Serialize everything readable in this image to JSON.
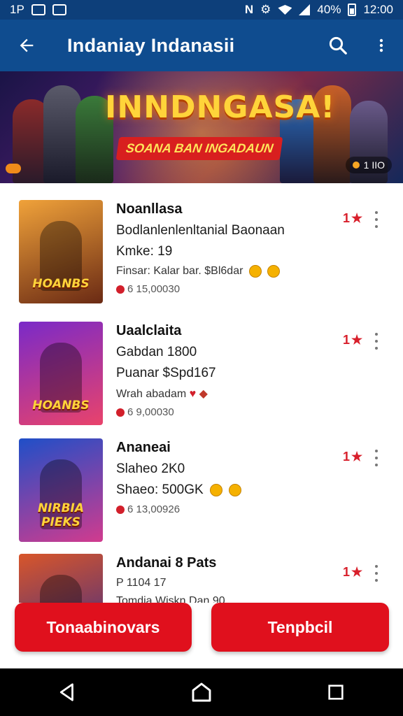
{
  "status_bar": {
    "left_text": "1P",
    "battery": "40%",
    "time": "12:00",
    "left_icons": [
      "gallery-icon",
      "message-icon"
    ],
    "right_icons": [
      "nfc-icon",
      "sync-icon",
      "wifi-icon",
      "signal-icon",
      "battery-icon"
    ]
  },
  "app_bar": {
    "title": "Indaniay Indanasii",
    "back_icon": "arrow-left-icon",
    "search_icon": "search-icon",
    "menu_icon": "more-vert-icon"
  },
  "banner": {
    "title": "INNDNGASA!",
    "subtitle": "SOANA BAN INGADAUN",
    "page_indicator": "1 IIO"
  },
  "items": [
    {
      "name": "Noanllasa",
      "line1": "Bodlanlenlenltanial Baonaan",
      "line2": "Kmke: 19",
      "line3": "Finsar: Kalar bar. $Bl6dar",
      "meta": "6 15,00030",
      "rating": "1",
      "thumb_label": "HOANBS",
      "thumb_colors": [
        "#f0a23a",
        "#6a2a14"
      ]
    },
    {
      "name": "Uaalclaita",
      "line1": "Gabdan 1800",
      "line2": "Puanar $Spd167",
      "line3": "Wrah abadam",
      "meta": "6 9,00030",
      "rating": "1",
      "thumb_label": "HOANBS",
      "thumb_colors": [
        "#7a2ac8",
        "#e9436b"
      ]
    },
    {
      "name": "Ananeai",
      "line1": "Slaheo 2K0",
      "line2": "Shaeo: 500GK",
      "line3": "",
      "meta": "6 13,00926",
      "rating": "1",
      "thumb_label": "NIRBIA PIEKS",
      "thumb_colors": [
        "#1f4fc8",
        "#d13b8e"
      ]
    },
    {
      "name": "Andanai 8 Pats",
      "line1": "P 1104 17",
      "line2": "Tomdia Wiskn Dan 90",
      "line3": "",
      "meta": "",
      "rating": "1",
      "thumb_label": "",
      "thumb_colors": [
        "#d8562a",
        "#3a2a8a"
      ]
    }
  ],
  "buttons": {
    "left": "Tonaabinovars",
    "right": "Tenpbcil"
  },
  "nav_bar": {
    "back": "back-triangle-icon",
    "home": "home-icon",
    "recents": "recents-square-icon"
  },
  "colors": {
    "app_bar": "#0f4c8f",
    "accent_red": "#e0101d",
    "star": "#d81f2b"
  }
}
